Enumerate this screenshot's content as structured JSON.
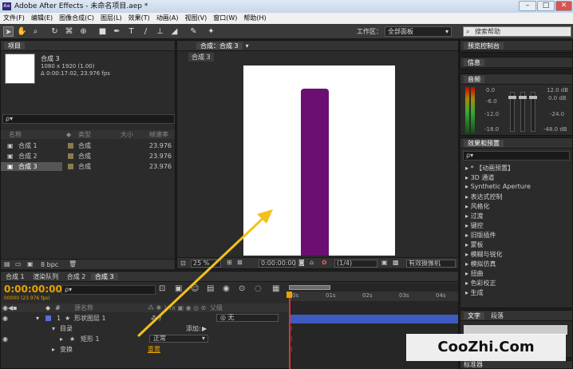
{
  "window": {
    "title": "Adobe After Effects - 未命名项目.aep *",
    "logo": "Ae"
  },
  "menu": [
    "文件(F)",
    "编辑(E)",
    "图像合成(C)",
    "图层(L)",
    "效果(T)",
    "动画(A)",
    "视图(V)",
    "窗口(W)",
    "帮助(H)"
  ],
  "toolbar": {
    "workspace_label": "工作区：",
    "workspace_value": "全部面板",
    "search_placeholder": "搜索帮助"
  },
  "project": {
    "tab": "项目",
    "comp_name": "合成 3",
    "comp_size": "1080 x 1920 (1.00)",
    "comp_duration": "Δ 0:00:17:02, 23.976 fps",
    "search_placeholder": "ρ▾",
    "columns": [
      "名称",
      "类型",
      "大小",
      "帧速率"
    ],
    "items": [
      {
        "name": "合成 1",
        "type": "合成",
        "rate": "23.976"
      },
      {
        "name": "合成 2",
        "type": "合成",
        "rate": "23.976"
      },
      {
        "name": "合成 3",
        "type": "合成",
        "rate": "23.976"
      }
    ],
    "bpc": "8 bpc"
  },
  "composition": {
    "tab": "合成：合成 3",
    "sub_tab": "合成 3",
    "zoom": "25 %",
    "timecode": "0:00:00:00",
    "resolution": "(1/4)",
    "camera": "有效摄像机",
    "bar_color": "#6b0f72"
  },
  "right_panels": {
    "preview": "预览控制台",
    "info": "信息",
    "audio": "音频",
    "audio_left": [
      "0.0",
      "-6.0",
      "-12.0",
      "-18.0"
    ],
    "audio_right": [
      "12.0 dB",
      "0.0 dB",
      "-24.0",
      "-48.0 dB"
    ],
    "effects_tab": "效果和预置",
    "effects_search": "ρ▾",
    "effects": [
      "* 【动画预置】",
      "3D 通道",
      "Synthetic Aperture",
      "表达式控制",
      "风格化",
      "过渡",
      "键控",
      "旧版插件",
      "蒙板",
      "模糊与锐化",
      "模拟仿真",
      "扭曲",
      "色彩校正",
      "生成"
    ],
    "text_tab": "文字",
    "para_tab": "段落",
    "bottom_tab": "标准器"
  },
  "timeline": {
    "tabs": [
      "合成 1",
      "渲染队列",
      "合成 2",
      "合成 3"
    ],
    "timecode": "0:00:00:00",
    "frames": "00000 (23.976 fps)",
    "col_name": "源名称",
    "col_parent": "父级",
    "layer_num": "1",
    "layer_name": "形状图层 1",
    "parent_value": "无",
    "contents": "目录",
    "add_label": "添加:",
    "rect": "矩形 1",
    "mode": "正常",
    "transform": "变换",
    "reset": "重置",
    "ruler": [
      "0s",
      "01s",
      "02s",
      "03s",
      "04s"
    ]
  },
  "watermark": "CooZhi.Com",
  "colors": {
    "accent": "#e8a200",
    "bar": "#3f5bbf",
    "purple": "#6b0f72"
  }
}
